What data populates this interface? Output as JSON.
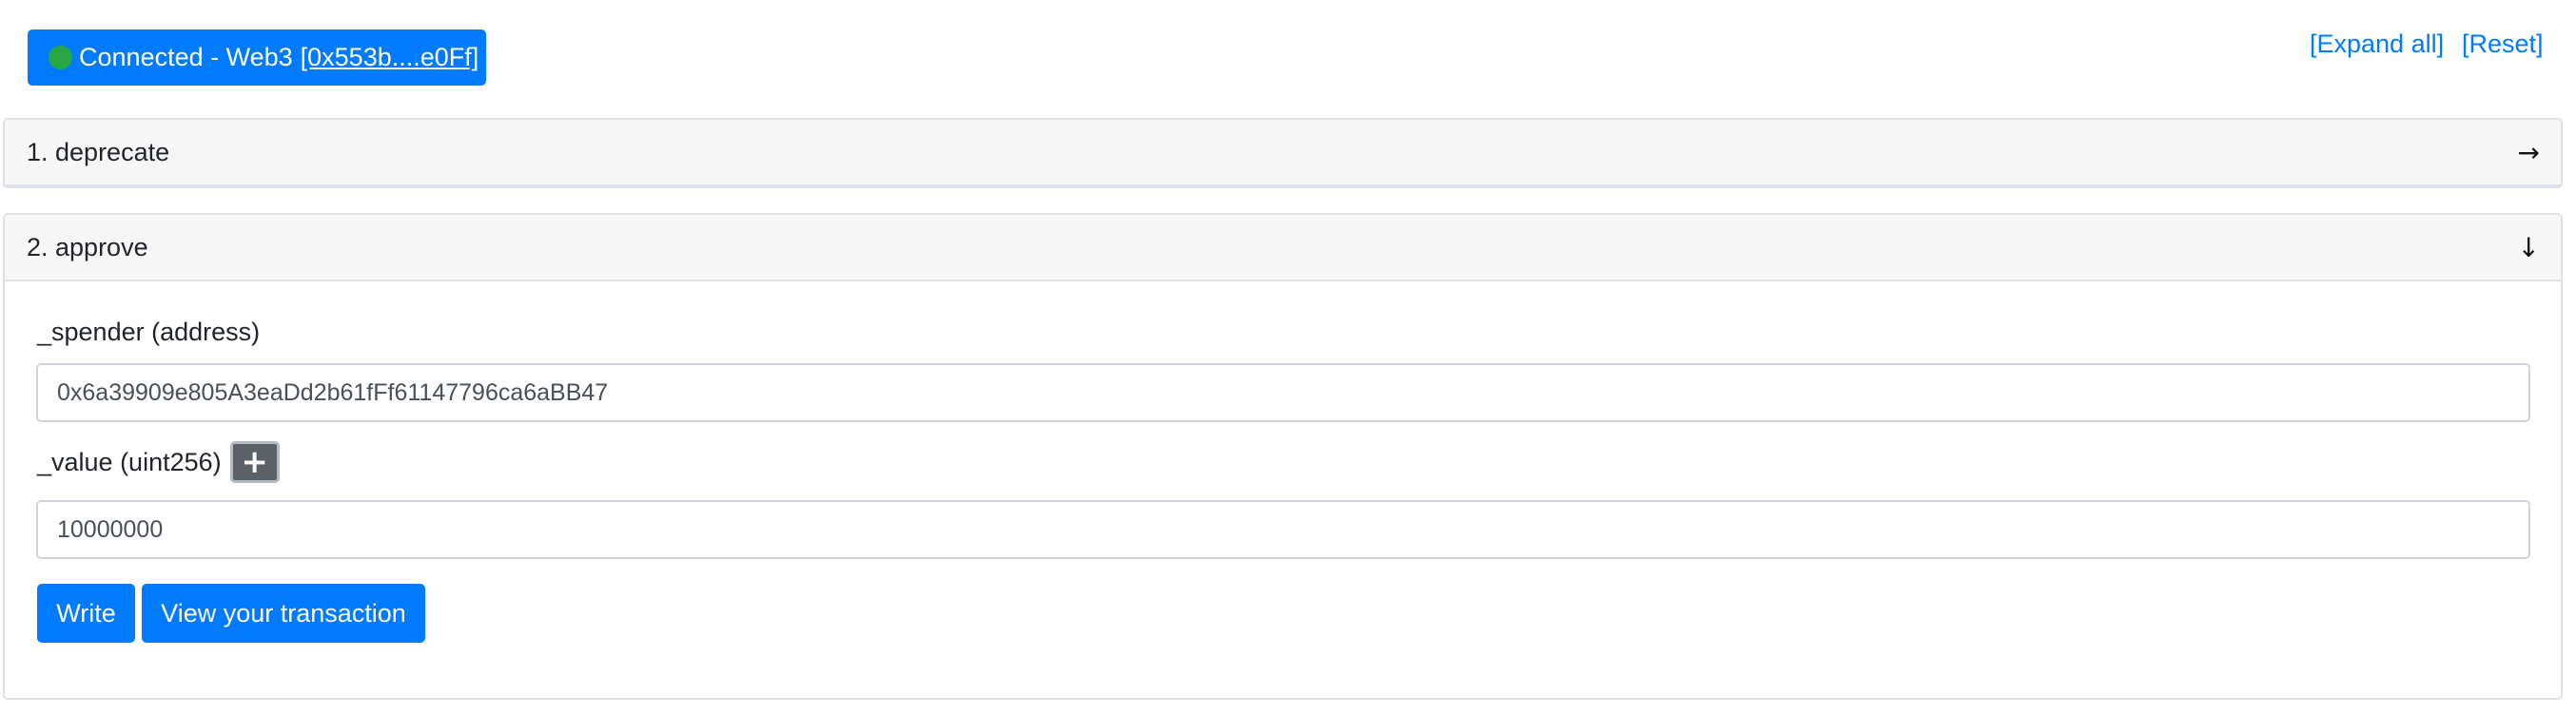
{
  "header": {
    "connection": {
      "status": "Connected - Web3",
      "address": "[0x553b....e0Ff]",
      "status_color": "#28a745"
    },
    "expand_all": "[Expand all]",
    "reset": "[Reset]"
  },
  "functions": [
    {
      "title": "1. deprecate",
      "arrow": "→",
      "state": "collapsed"
    },
    {
      "title": "2. approve",
      "arrow": "↓",
      "state": "expanded",
      "params": [
        {
          "label": "_spender (address)",
          "value": "0x6a39909e805A3eaDd2b61fFf61147796ca6aBB47"
        },
        {
          "label": "_value (uint256)",
          "value": "10000000",
          "add_icon": "+"
        }
      ],
      "write_label": "Write",
      "view_tx_label": "View your transaction"
    }
  ],
  "colors": {
    "primary": "#007bff",
    "secondary": "#5a6268",
    "header_bg": "#f7f7f8",
    "border": "#dee2e6"
  }
}
